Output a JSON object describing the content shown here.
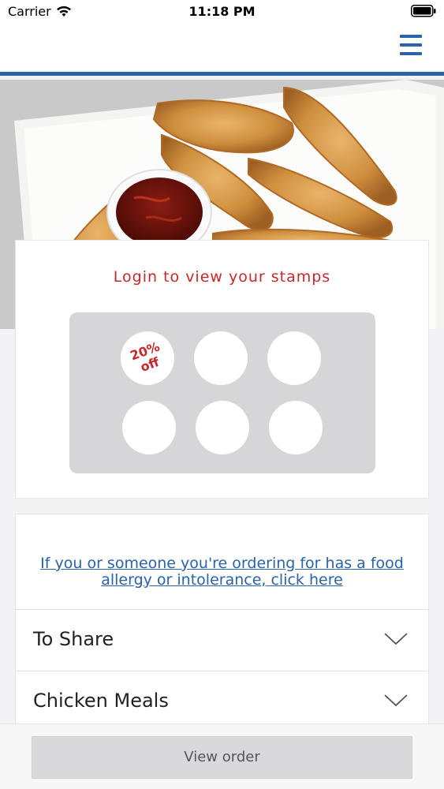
{
  "status_bar": {
    "carrier": "Carrier",
    "time": "11:18 PM",
    "wifi_icon": "wifi-icon",
    "battery_icon": "battery-icon"
  },
  "header": {
    "menu_icon": "hamburger-menu-icon",
    "accent_color": "#2b62a8"
  },
  "hero": {
    "description_icon": "chicken-tenders-photo"
  },
  "stamps": {
    "title": "Login to view your stamps",
    "reward_line1": "20%",
    "reward_line2": "off",
    "slot_count": 6,
    "accent_color": "#c8282a"
  },
  "menu": {
    "allergy_link": "If you or someone you're ordering for has a food allergy or intolerance, click here",
    "categories": [
      {
        "label": "To Share"
      },
      {
        "label": "Chicken Meals"
      }
    ]
  },
  "footer": {
    "view_order_label": "View order"
  }
}
